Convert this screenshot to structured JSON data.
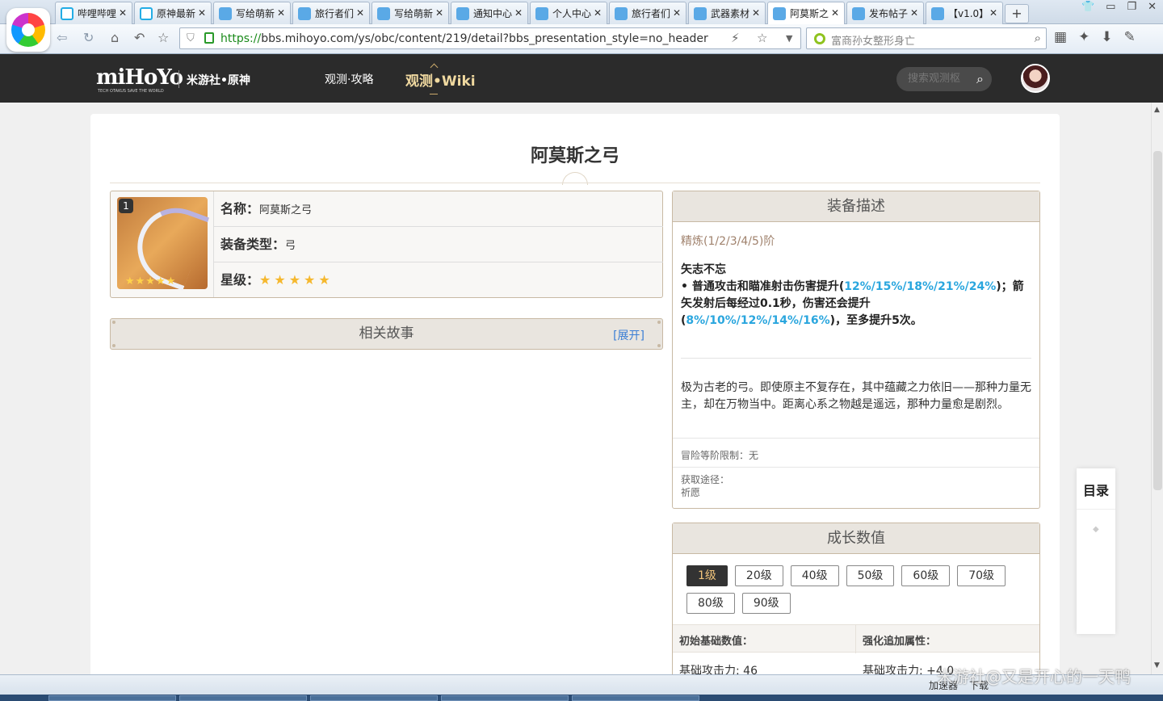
{
  "browser": {
    "tabs": [
      {
        "title": "哔哩哔哩",
        "icon": "bilibili-icon"
      },
      {
        "title": "原神最新",
        "icon": "bilibili-icon"
      },
      {
        "title": "写给萌新",
        "icon": "mihoyo-icon"
      },
      {
        "title": "旅行者们",
        "icon": "mihoyo-icon"
      },
      {
        "title": "写给萌新",
        "icon": "mihoyo-icon"
      },
      {
        "title": "通知中心",
        "icon": "mihoyo-icon"
      },
      {
        "title": "个人中心",
        "icon": "mihoyo-icon"
      },
      {
        "title": "旅行者们",
        "icon": "mihoyo-icon"
      },
      {
        "title": "武器素材",
        "icon": "mihoyo-icon"
      },
      {
        "title": "阿莫斯之",
        "icon": "mihoyo-icon",
        "active": true
      },
      {
        "title": "发布帖子",
        "icon": "mihoyo-icon"
      },
      {
        "title": "【v1.0】",
        "icon": "mihoyo-icon"
      }
    ],
    "url_scheme": "https://",
    "url_rest": "bbs.mihoyo.com/ys/obc/content/219/detail?bbs_presentation_style=no_header",
    "search_text": "富商孙女整形身亡"
  },
  "site": {
    "brand": "miHoYo",
    "brand_tagline": "TECH OTAKUS SAVE THE WORLD",
    "site_name": "米游社•原神",
    "nav": [
      "观测·攻略",
      "观测•Wiki"
    ],
    "search_placeholder": "搜索观测枢"
  },
  "weapon": {
    "title": "阿莫斯之弓",
    "refine_badge": "1",
    "name_label": "名称：",
    "name_value": "阿莫斯之弓",
    "type_label": "装备类型：",
    "type_value": "弓",
    "rarity_label": "星级：",
    "rarity": 5,
    "rarity_stars": "★★★★★"
  },
  "story": {
    "header": "相关故事",
    "expand": "[展开]"
  },
  "description": {
    "header": "装备描述",
    "refine_label": "精炼(1/2/3/4/5)阶",
    "passive_name": "矢志不忘",
    "passive_p1": "• 普通攻击和瞄准射击伤害提升(",
    "passive_hl1": "12%/15%/18%/21%/24%",
    "passive_p2": ")；箭矢发射后每经过0.1秒，伤害还会提升(",
    "passive_hl2": "8%/10%/12%/14%/16%",
    "passive_p3": ")，至多提升5次。",
    "lore": "极为古老的弓。即使原主不复存在，其中蕴藏之力依旧——那种力量无主，却在万物当中。距离心系之物越是遥远，那种力量愈是剧烈。",
    "ar_limit": "冒险等阶限制：无",
    "source_label": "获取途径：",
    "source_value": "祈愿"
  },
  "growth": {
    "header": "成长数值",
    "levels": [
      "1级",
      "20级",
      "40级",
      "50级",
      "60级",
      "70级",
      "80级",
      "90级"
    ],
    "selected": "1级",
    "col_base": "初始基础数值：",
    "col_ascend": "强化追加属性：",
    "base_atk": "基础攻击力: 46",
    "ascend_atk": "基础攻击力: +4.0"
  },
  "toc": {
    "label": "目录"
  },
  "statusbar": {
    "watermark": "米游社@又是开心的一天鸭",
    "accelerator": "加速器",
    "download": "下载"
  },
  "colors": {
    "header_bg": "#2b2b2b",
    "accent_gold": "#f0d9a0",
    "highlight_blue": "#2aa6de",
    "panel_border": "#c8b9a4"
  }
}
